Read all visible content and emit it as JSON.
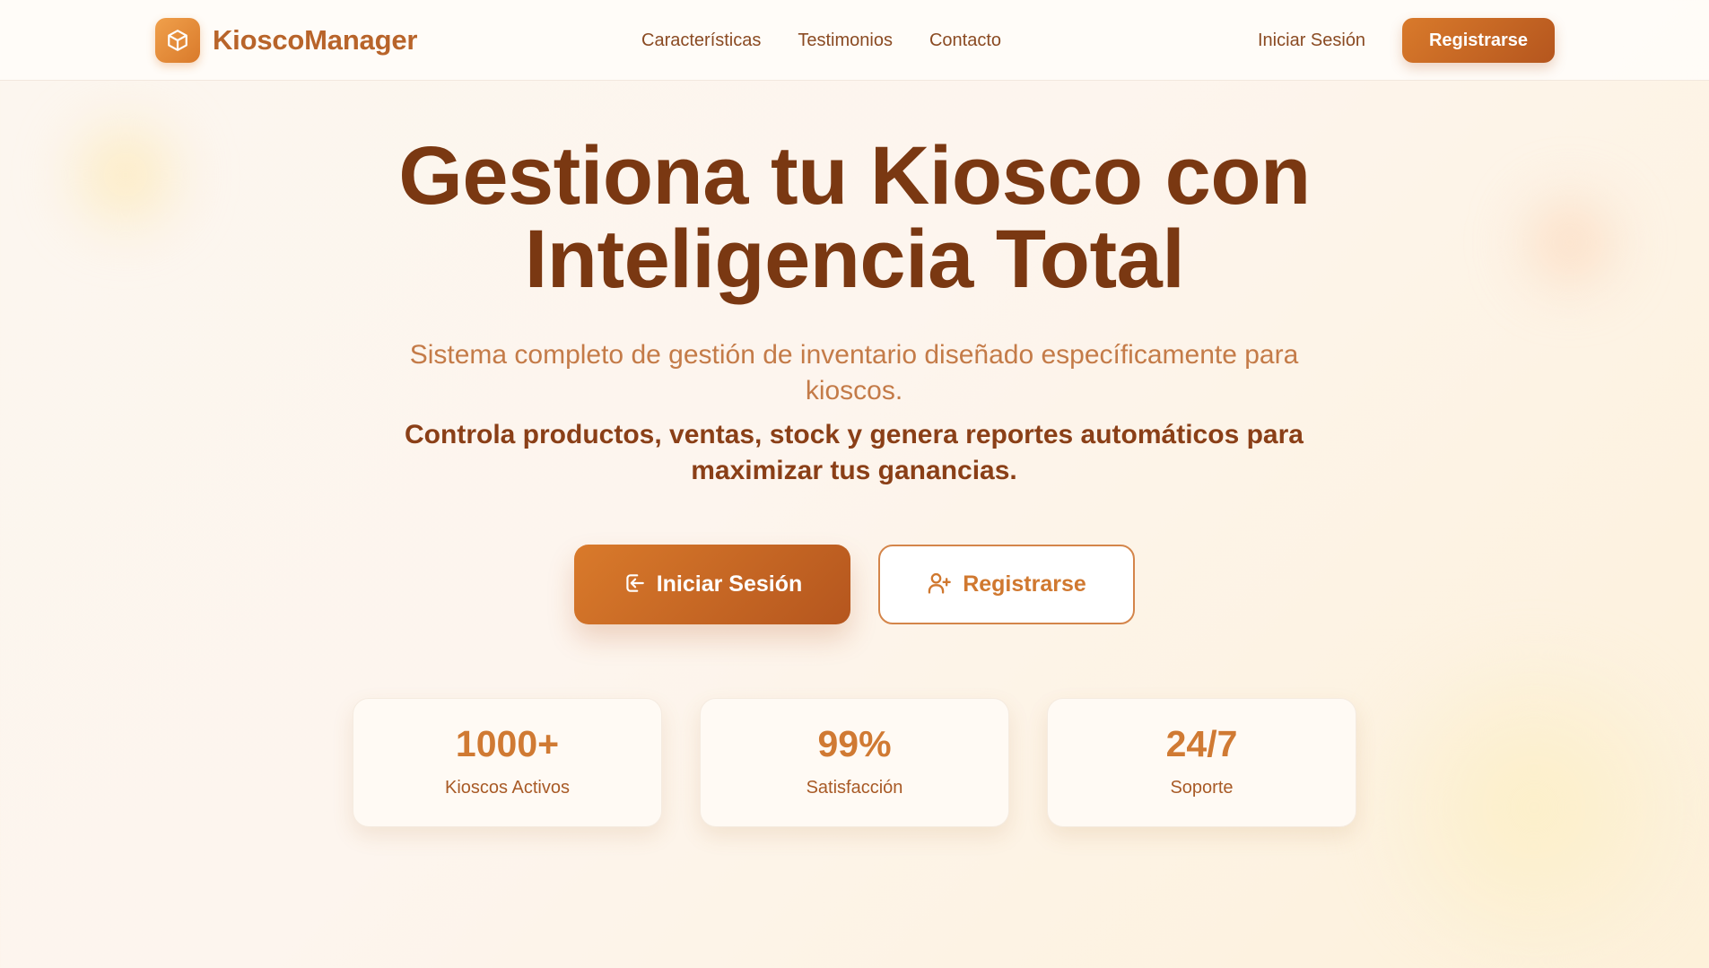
{
  "brand": {
    "name": "KioscoManager",
    "logo_icon": "cube-icon"
  },
  "nav": {
    "links": [
      "Características",
      "Testimonios",
      "Contacto"
    ],
    "login_label": "Iniciar Sesión",
    "register_label": "Registrarse"
  },
  "hero": {
    "title_line1": "Gestiona tu Kiosco con",
    "title_line2": "Inteligencia Total",
    "subtitle": "Sistema completo de gestión de inventario diseñado específicamente para kioscos.",
    "description": "Controla productos, ventas, stock y genera reportes automáticos para maximizar tus ganancias.",
    "primary_button": {
      "label": "Iniciar Sesión",
      "icon": "login-icon"
    },
    "secondary_button": {
      "label": "Registrarse",
      "icon": "user-plus-icon"
    }
  },
  "stats": [
    {
      "value": "1000+",
      "label": "Kioscos Activos"
    },
    {
      "value": "99%",
      "label": "Satisfacción"
    },
    {
      "value": "24/7",
      "label": "Soporte"
    }
  ],
  "colors": {
    "accent": "#d97a2b",
    "accent_dark": "#b5561e",
    "title": "#7a3812",
    "text_brown": "#8a4a22"
  }
}
